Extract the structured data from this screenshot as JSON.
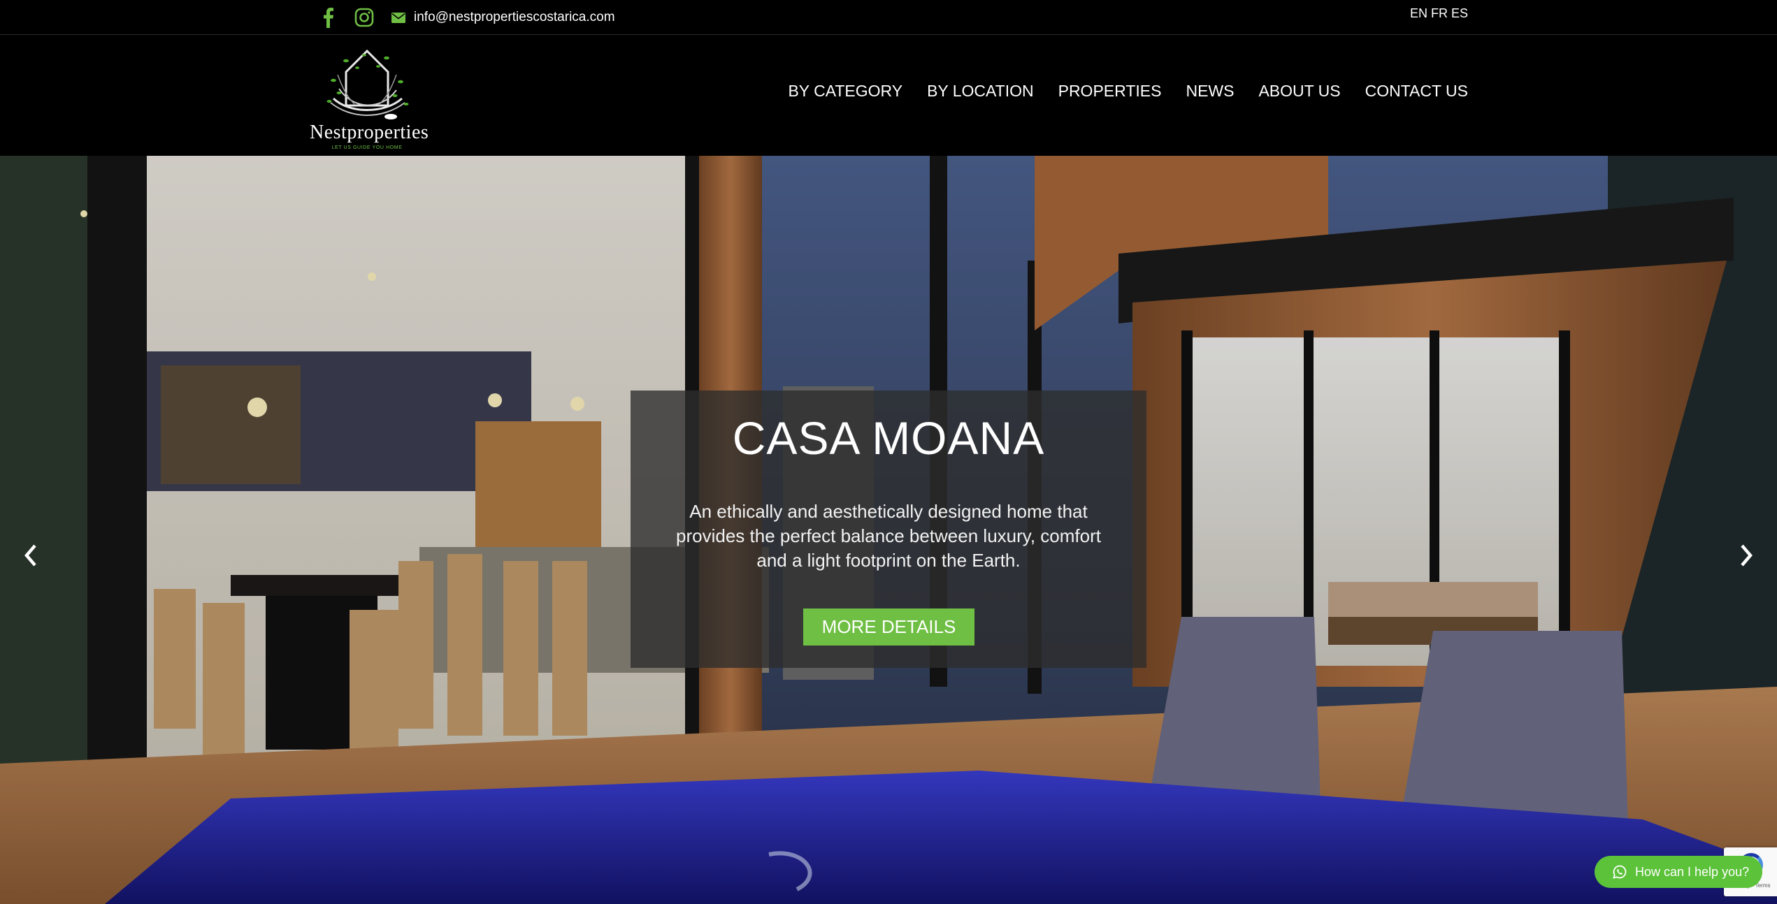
{
  "topbar": {
    "email": "info@nestpropertiescostarica.com",
    "languages": [
      "EN",
      "FR",
      "ES"
    ]
  },
  "brand": {
    "name": "Nestproperties",
    "tagline": "LET US GUIDE YOU HOME",
    "accent_color": "#6fbf44"
  },
  "nav": {
    "items": [
      "BY CATEGORY",
      "BY LOCATION",
      "PROPERTIES",
      "NEWS",
      "ABOUT US",
      "CONTACT US"
    ]
  },
  "hero": {
    "title": "CASA MOANA",
    "description": "An ethically and aesthetically designed home that provides the perfect balance between luxury, comfort and a light footprint on the Earth.",
    "button_label": "MORE DETAILS"
  },
  "whatsapp": {
    "label": "How can I help you?",
    "color": "#5cc23a"
  },
  "recaptcha": {
    "text": "Privacy - Terms"
  },
  "icons": {
    "facebook": "facebook-icon",
    "instagram": "instagram-icon",
    "email": "envelope-icon",
    "prev": "chevron-left-icon",
    "next": "chevron-right-icon",
    "whatsapp": "whatsapp-icon"
  }
}
